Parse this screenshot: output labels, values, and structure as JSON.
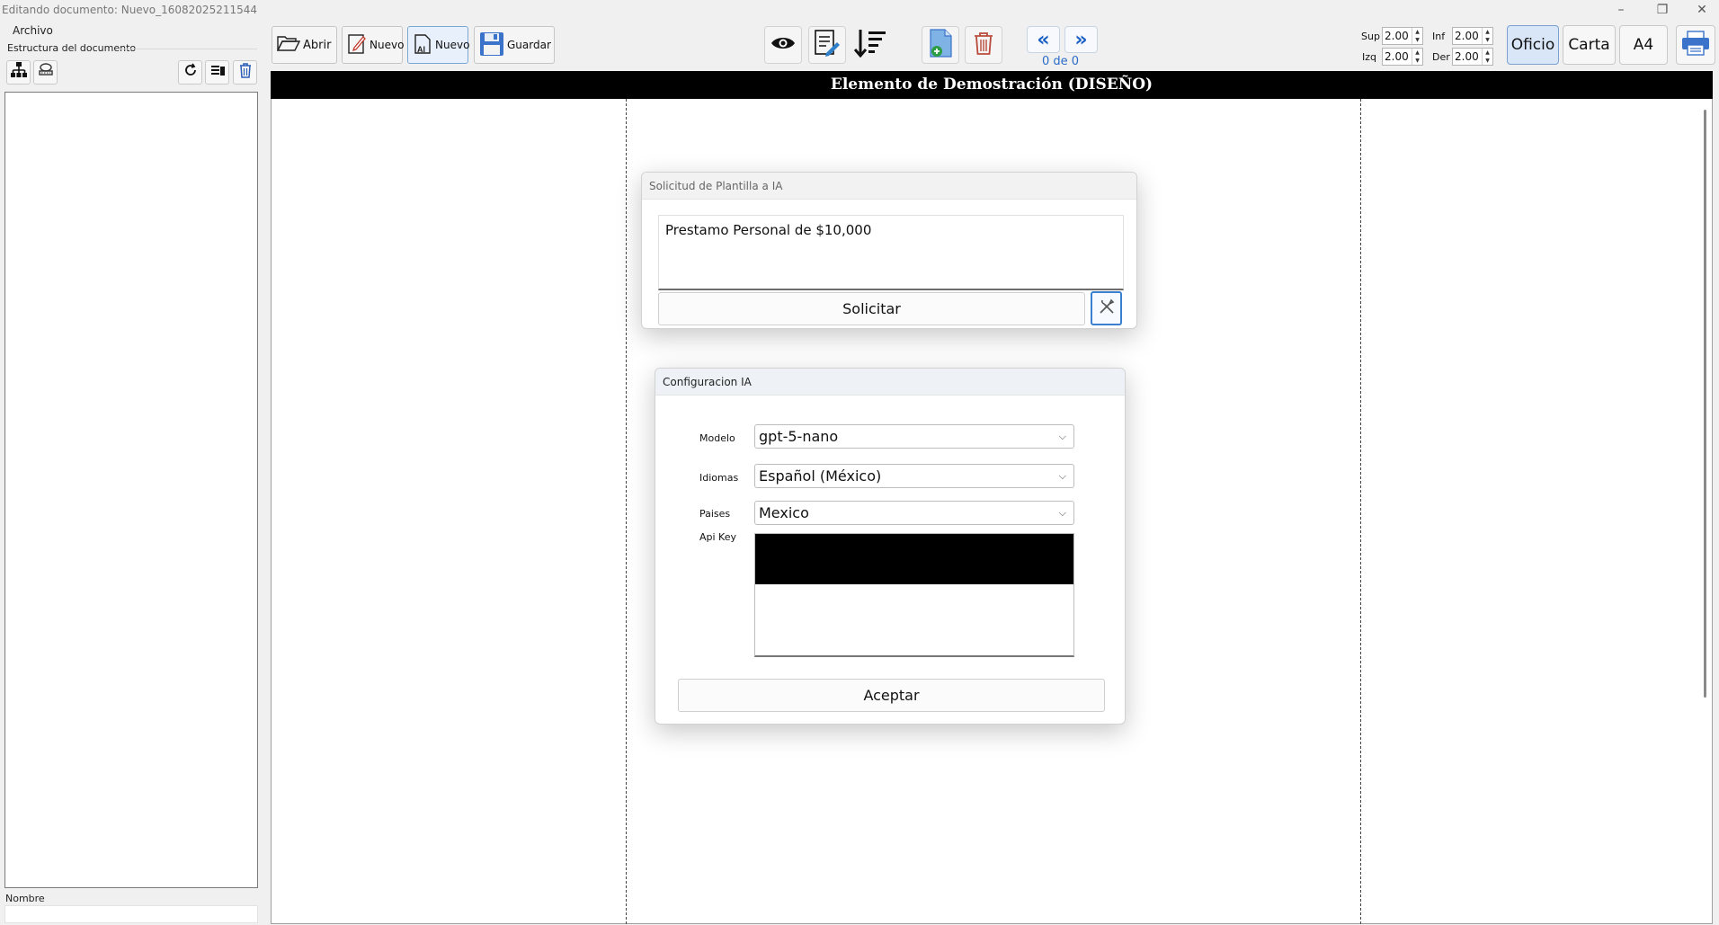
{
  "window": {
    "title": "Editando documento: Nuevo_16082025211544",
    "controls": [
      "minimize-icon",
      "restore-icon",
      "close-icon"
    ]
  },
  "menu": {
    "archivo": "Archivo"
  },
  "left_panel": {
    "group_label": "Estructura del documento",
    "tools": [
      "hierarchy-icon",
      "stamp-icon",
      "refresh-icon",
      "sort-delete-icon",
      "trash-icon"
    ],
    "nombre_label": "Nombre",
    "nombre_value": ""
  },
  "toolbar": {
    "abrir": "Abrir",
    "nuevo": "Nuevo",
    "nuevo_ai": "Nuevo",
    "guardar": "Guardar",
    "icons": [
      "eye-icon",
      "edit-document-icon",
      "sort-descending-icon",
      "add-page-icon",
      "trash-icon"
    ],
    "page_count": "0 de 0"
  },
  "margins": {
    "sup_label": "Sup",
    "sup": "2.00",
    "inf_label": "Inf",
    "inf": "2.00",
    "izq_label": "Izq",
    "izq": "2.00",
    "der_label": "Der",
    "der": "2.00"
  },
  "paper_sizes": {
    "oficio": "Oficio",
    "carta": "Carta",
    "a4": "A4",
    "selected": "Oficio"
  },
  "document": {
    "header": "Elemento de Demostración (DISEÑO)"
  },
  "ai_request_dialog": {
    "title": "Solicitud de Plantilla a IA",
    "prompt": "Prestamo Personal de $10,000",
    "solicitar": "Solicitar"
  },
  "ai_config_dialog": {
    "title": "Configuracion IA",
    "modelo_label": "Modelo",
    "modelo": "gpt-5-nano",
    "idiomas_label": "Idiomas",
    "idioma": "Español (México)",
    "paises_label": "Paises",
    "pais": "Mexico",
    "api_key_label": "Api Key",
    "aceptar": "Aceptar"
  },
  "colors": {
    "accent": "#2a6cc7",
    "selected_paper_bg": "#d8e6f7",
    "header_bg": "#000000"
  }
}
